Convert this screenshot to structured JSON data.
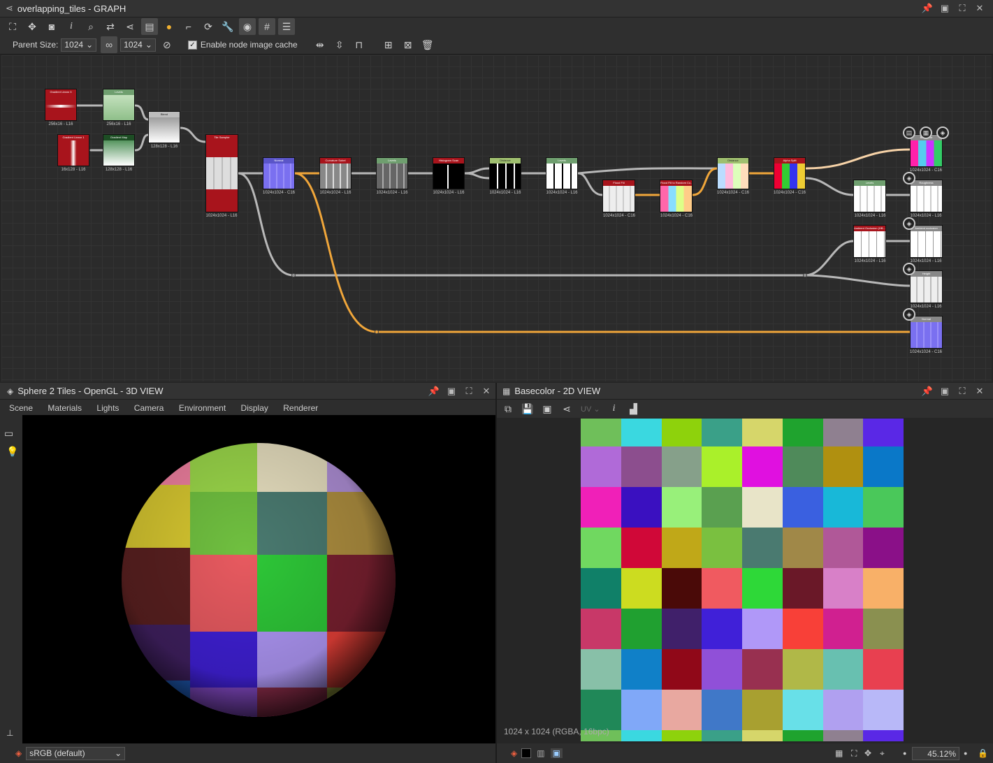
{
  "graph": {
    "title": "overlapping_tiles - GRAPH",
    "parent_size_label": "Parent Size:",
    "parent_size_value": "1024",
    "size_value_2": "1024",
    "cache_label": "Enable node image cache",
    "cache_checked": true,
    "nodes": [
      {
        "id": "grad-linear-3",
        "title": "Gradient Linear 3",
        "header": "#a8141c",
        "size": "256x16 - L16"
      },
      {
        "id": "levels-1",
        "title": "Levels",
        "header": "#6f9f6f",
        "size": "256x16 - L16"
      },
      {
        "id": "grad-linear-1",
        "title": "Gradient Linear 1",
        "header": "#a8141c",
        "size": "16x128 - L16"
      },
      {
        "id": "gradient-map",
        "title": "Gradient Map",
        "header": "#2f7d3a",
        "size": "128x128 - L16"
      },
      {
        "id": "blend",
        "title": "Blend",
        "header": "#bdbdbd",
        "size": "128x128 - L16"
      },
      {
        "id": "tile-sampler",
        "title": "Tile Sampler",
        "header": "#a8141c",
        "size": "1024x1024 - L16"
      },
      {
        "id": "normal",
        "title": "Normal",
        "header": "#5a55c8",
        "size": "1024x1024 - C16"
      },
      {
        "id": "curvature-sobel",
        "title": "Curvature Sobel",
        "header": "#a8141c",
        "size": "1024x1024 - L16"
      },
      {
        "id": "levels-2",
        "title": "Levels",
        "header": "#6f9f6f",
        "size": "1024x1024 - L16"
      },
      {
        "id": "histogram-scan",
        "title": "Histogram Scan",
        "header": "#a8141c",
        "size": "1024x1024 - L16"
      },
      {
        "id": "distance",
        "title": "Distance",
        "header": "#9fbf6f",
        "size": "1024x1024 - L16"
      },
      {
        "id": "levels-3",
        "title": "Levels",
        "header": "#6f9f6f",
        "size": "1024x1024 - L16"
      },
      {
        "id": "flood-fill",
        "title": "Flood Fill",
        "header": "#a8141c",
        "size": "1024x1024 - C16"
      },
      {
        "id": "flood-fill-random",
        "title": "Flood Fill to Random Co...",
        "header": "#a8141c",
        "size": "1024x1024 - C16"
      },
      {
        "id": "distance-2",
        "title": "Distance",
        "header": "#9fbf6f",
        "size": "1024x1024 - C16"
      },
      {
        "id": "alpha-split",
        "title": "Alpha Split",
        "header": "#a8141c",
        "size": "1024x1024 - C16"
      },
      {
        "id": "levels-4",
        "title": "Levels",
        "header": "#6f9f6f",
        "size": "1024x1024 - L16"
      },
      {
        "id": "ambient-occlusion",
        "title": "Ambient Occlusion (HB...",
        "header": "#a8141c",
        "size": "1024x1024 - L16"
      },
      {
        "id": "out-basecolor",
        "title": "Basecolor",
        "header": "#888888",
        "size": "1024x1024 - C16"
      },
      {
        "id": "out-roughness",
        "title": "Roughness",
        "header": "#888888",
        "size": "1024x1024 - L16"
      },
      {
        "id": "out-ao",
        "title": "Ambient occlusion",
        "header": "#888888",
        "size": "1024x1024 - L16"
      },
      {
        "id": "out-height",
        "title": "Height",
        "header": "#888888",
        "size": "1024x1024 - L16"
      },
      {
        "id": "out-normal",
        "title": "Normal",
        "header": "#888888",
        "size": "1024x1024 - C16"
      }
    ]
  },
  "view3d": {
    "title": "Sphere 2 Tiles - OpenGL - 3D VIEW",
    "menu": [
      "Scene",
      "Materials",
      "Lights",
      "Camera",
      "Environment",
      "Display",
      "Renderer"
    ],
    "colorspace": "sRGB (default)"
  },
  "view2d": {
    "title": "Basecolor - 2D VIEW",
    "uv_label": "UV",
    "info": "1024 x 1024 (RGBA, 16bpc)",
    "zoom": "45.12%",
    "tiles": [
      "#6fbf5a",
      "#3ad8e0",
      "#8ed20c",
      "#3aa088",
      "#d6d66a",
      "#1fa32e",
      "#8f8090",
      "#5a28e6",
      "#b06ad8",
      "#8c4e8e",
      "#86a08a",
      "#aaf02a",
      "#e010e0",
      "#4f8a5a",
      "#b09010",
      "#0a78c8",
      "#f020b8",
      "#3a10c0",
      "#98f07a",
      "#5aa050",
      "#e8e4c8",
      "#3a60e0",
      "#18b8d8",
      "#4ac85a",
      "#70d860",
      "#d00838",
      "#c0a818",
      "#7ac040",
      "#4a7a70",
      "#a08848",
      "#b05898",
      "#8a1088",
      "#108068",
      "#ccdc20",
      "#4a0a08",
      "#f05a60",
      "#2ed838",
      "#6a1828",
      "#d880c8",
      "#f8b068",
      "#c83868",
      "#20a030",
      "#40206a",
      "#4020d8",
      "#b098f8",
      "#f84038",
      "#d02090",
      "#8a9050",
      "#88c0a8",
      "#1080c8",
      "#900818",
      "#9050d8",
      "#983050",
      "#b0b848",
      "#68c0b0",
      "#e84050",
      "#208858",
      "#80a8f8",
      "#e8a8a0",
      "#4078c8",
      "#a8a030",
      "#68e0e8",
      "#b0a0f0",
      "#b8b8f8"
    ]
  }
}
